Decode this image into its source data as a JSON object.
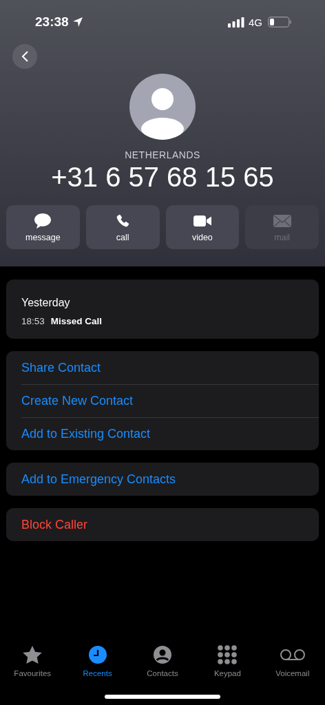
{
  "status_bar": {
    "time": "23:38",
    "network": "4G"
  },
  "contact": {
    "region": "NETHERLANDS",
    "number": "+31 6 57 68 15 65"
  },
  "actions": [
    {
      "kind": "message",
      "label": "message",
      "disabled": false
    },
    {
      "kind": "call",
      "label": "call",
      "disabled": false
    },
    {
      "kind": "video",
      "label": "video",
      "disabled": false
    },
    {
      "kind": "mail",
      "label": "mail",
      "disabled": true
    }
  ],
  "call_log": {
    "day": "Yesterday",
    "time": "18:53",
    "type": "Missed Call"
  },
  "option_groups": [
    {
      "items": [
        {
          "label": "Share Contact",
          "kind": "normal"
        },
        {
          "label": "Create New Contact",
          "kind": "normal"
        },
        {
          "label": "Add to Existing Contact",
          "kind": "normal"
        }
      ]
    },
    {
      "items": [
        {
          "label": "Add to Emergency Contacts",
          "kind": "normal"
        }
      ]
    },
    {
      "items": [
        {
          "label": "Block Caller",
          "kind": "destructive"
        }
      ]
    }
  ],
  "tabs": [
    {
      "kind": "favourites",
      "label": "Favourites",
      "selected": false
    },
    {
      "kind": "recents",
      "label": "Recents",
      "selected": true
    },
    {
      "kind": "contacts",
      "label": "Contacts",
      "selected": false
    },
    {
      "kind": "keypad",
      "label": "Keypad",
      "selected": false
    },
    {
      "kind": "voicemail",
      "label": "Voicemail",
      "selected": false
    }
  ]
}
